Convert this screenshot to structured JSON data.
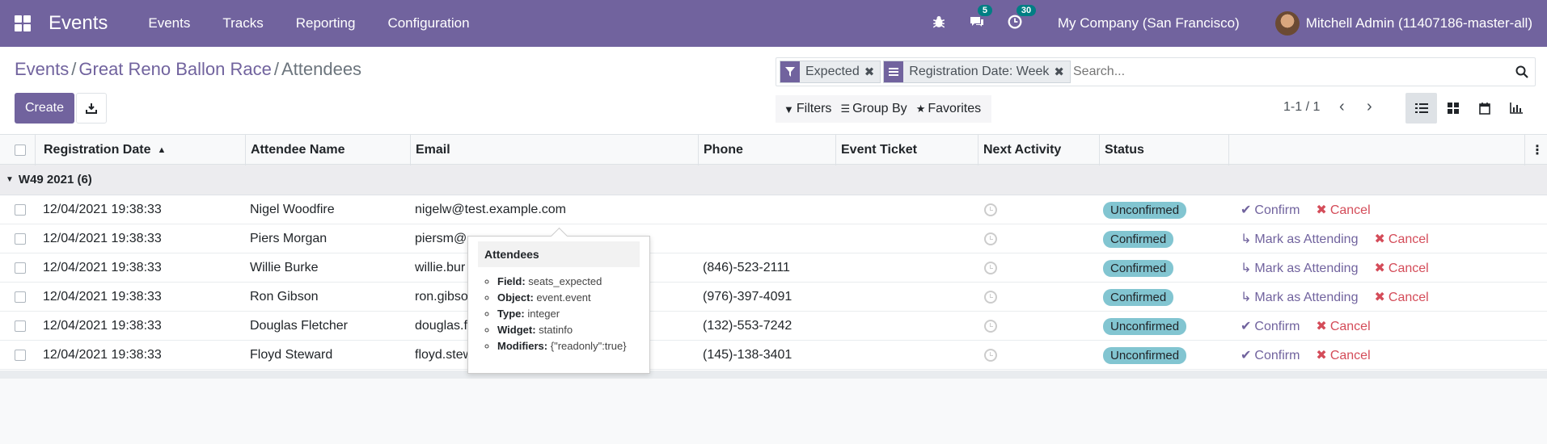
{
  "topbar": {
    "app_title": "Events",
    "menu": [
      "Events",
      "Tracks",
      "Reporting",
      "Configuration"
    ],
    "chat_badge": "5",
    "activity_badge": "30",
    "company": "My Company (San Francisco)",
    "user": "Mitchell Admin (11407186-master-all)"
  },
  "breadcrumb": {
    "items": [
      "Events",
      "Great Reno Ballon Race"
    ],
    "current": "Attendees",
    "separator": "/"
  },
  "buttons": {
    "create": "Create"
  },
  "search": {
    "facets": [
      "Expected",
      "Registration Date: Week"
    ],
    "placeholder": "Search..."
  },
  "filters": {
    "filters": "Filters",
    "group_by": "Group By",
    "favorites": "Favorites"
  },
  "pager": {
    "text": "1-1 / 1"
  },
  "table": {
    "columns": [
      "Registration Date",
      "Attendee Name",
      "Email",
      "Phone",
      "Event Ticket",
      "Next Activity",
      "Status"
    ],
    "group_label": "W49 2021 (6)",
    "rows": [
      {
        "date": "12/04/2021 19:38:33",
        "name": "Nigel Woodfire",
        "email": "nigelw@test.example.com",
        "phone": "",
        "status": "Unconfirmed",
        "action": "Confirm",
        "cancel": "Cancel"
      },
      {
        "date": "12/04/2021 19:38:33",
        "name": "Piers Morgan",
        "email": "piersm@",
        "phone": "",
        "status": "Confirmed",
        "action": "Mark as Attending",
        "cancel": "Cancel"
      },
      {
        "date": "12/04/2021 19:38:33",
        "name": "Willie Burke",
        "email": "willie.bur",
        "phone": "(846)-523-2111",
        "status": "Confirmed",
        "action": "Mark as Attending",
        "cancel": "Cancel"
      },
      {
        "date": "12/04/2021 19:38:33",
        "name": "Ron Gibson",
        "email": "ron.gibso",
        "phone": "(976)-397-4091",
        "status": "Confirmed",
        "action": "Mark as Attending",
        "cancel": "Cancel"
      },
      {
        "date": "12/04/2021 19:38:33",
        "name": "Douglas Fletcher",
        "email": "douglas.f",
        "phone": "(132)-553-7242",
        "status": "Unconfirmed",
        "action": "Confirm",
        "cancel": "Cancel"
      },
      {
        "date": "12/04/2021 19:38:33",
        "name": "Floyd Steward",
        "email": "floyd.stew",
        "phone": "(145)-138-3401",
        "status": "Unconfirmed",
        "action": "Confirm",
        "cancel": "Cancel"
      }
    ]
  },
  "tooltip": {
    "title": "Attendees",
    "items": [
      {
        "key": "Field:",
        "value": "seats_expected"
      },
      {
        "key": "Object:",
        "value": "event.event"
      },
      {
        "key": "Type:",
        "value": "integer"
      },
      {
        "key": "Widget:",
        "value": "statinfo"
      },
      {
        "key": "Modifiers:",
        "value": "{\"readonly\":true}"
      }
    ]
  },
  "colors": {
    "brand": "#71639e",
    "status_badge": "#82c5d1",
    "cancel": "#d44c59",
    "badge": "#017e84"
  }
}
